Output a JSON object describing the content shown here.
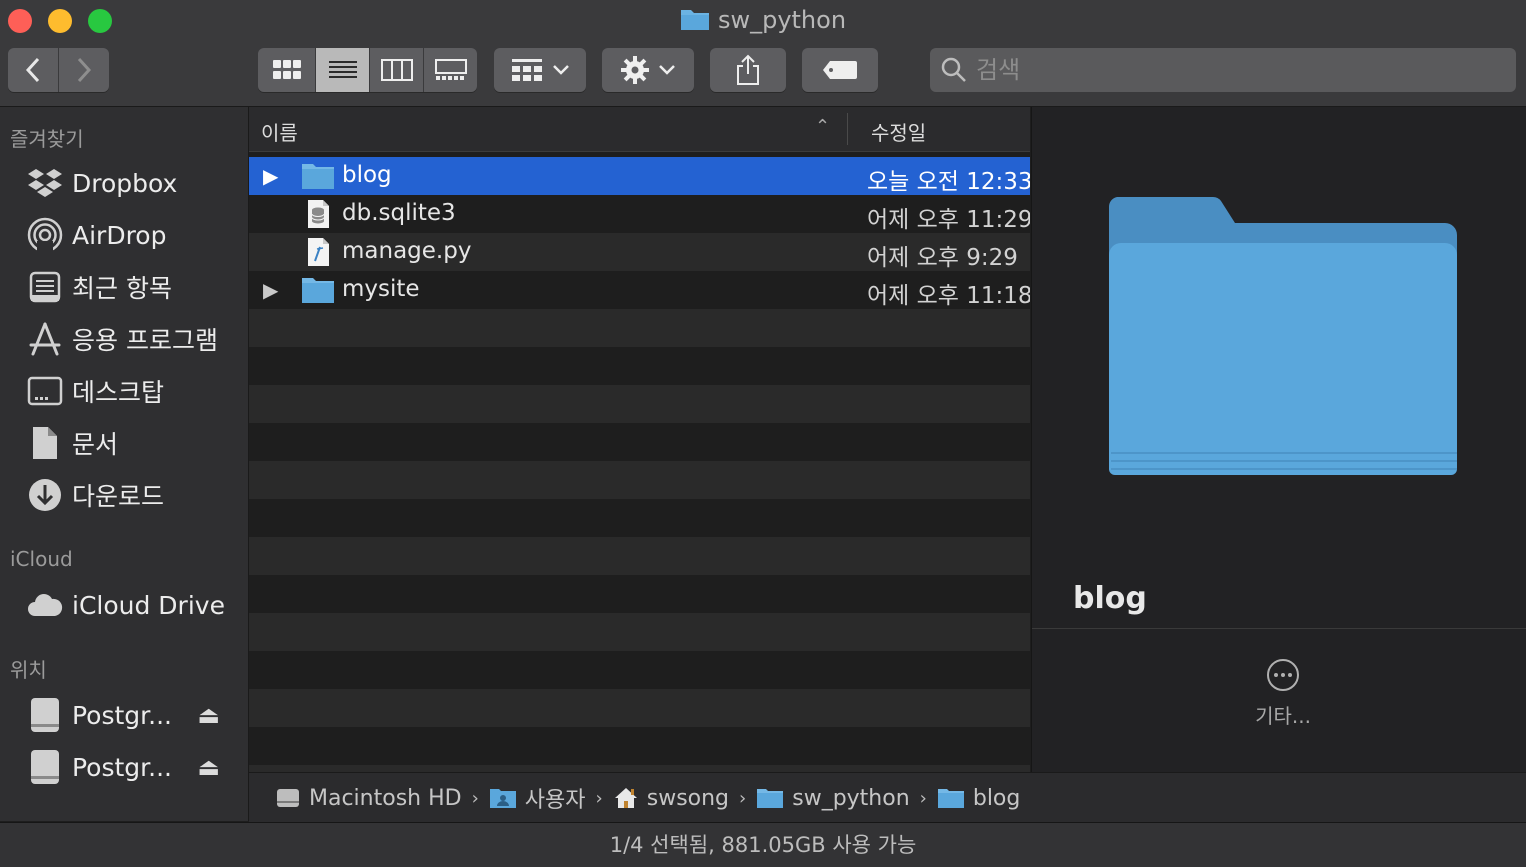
{
  "window": {
    "title": "sw_python"
  },
  "toolbar": {
    "view_modes": [
      {
        "id": "icon",
        "icon": "grid-view-icon",
        "active": false
      },
      {
        "id": "list",
        "icon": "list-view-icon",
        "active": true
      },
      {
        "id": "column",
        "icon": "column-view-icon",
        "active": false
      },
      {
        "id": "gallery",
        "icon": "gallery-view-icon",
        "active": false
      }
    ],
    "search_placeholder": "검색"
  },
  "sidebar": {
    "favorites_header": "즐겨찾기",
    "favorites": [
      {
        "label": "Dropbox",
        "icon": "dropbox-icon"
      },
      {
        "label": "AirDrop",
        "icon": "airdrop-icon"
      },
      {
        "label": "최근 항목",
        "icon": "recents-icon"
      },
      {
        "label": "응용 프로그램",
        "icon": "applications-icon"
      },
      {
        "label": "데스크탑",
        "icon": "desktop-icon"
      },
      {
        "label": "문서",
        "icon": "documents-icon"
      },
      {
        "label": "다운로드",
        "icon": "downloads-icon"
      }
    ],
    "icloud_header": "iCloud",
    "icloud": [
      {
        "label": "iCloud Drive",
        "icon": "cloud-icon"
      }
    ],
    "locations_header": "위치",
    "locations": [
      {
        "label": "Postgr...",
        "icon": "disk-icon"
      },
      {
        "label": "Postgr...",
        "icon": "disk-icon"
      }
    ]
  },
  "list": {
    "col_name": "이름",
    "col_date": "수정일",
    "files": [
      {
        "name": "blog",
        "date": "오늘 오전 12:33",
        "kind": "folder",
        "expandable": true,
        "selected": true
      },
      {
        "name": "db.sqlite3",
        "date": "어제 오후 11:29",
        "kind": "database",
        "expandable": false,
        "selected": false
      },
      {
        "name": "manage.py",
        "date": "어제 오후 9:29",
        "kind": "python",
        "expandable": false,
        "selected": false
      },
      {
        "name": "mysite",
        "date": "어제 오후 11:18",
        "kind": "folder",
        "expandable": true,
        "selected": false
      }
    ]
  },
  "preview": {
    "name": "blog",
    "more_label": "기타..."
  },
  "pathbar": [
    {
      "label": "Macintosh HD",
      "icon": "hard-drive-icon"
    },
    {
      "label": "사용자",
      "icon": "users-folder-icon"
    },
    {
      "label": "swsong",
      "icon": "home-icon"
    },
    {
      "label": "sw_python",
      "icon": "folder-icon"
    },
    {
      "label": "blog",
      "icon": "folder-icon"
    }
  ],
  "status": {
    "text": "1/4 선택됨, 881.05GB 사용 가능"
  },
  "colors": {
    "selection": "#2462d2",
    "folder": "#5aa7dc"
  }
}
